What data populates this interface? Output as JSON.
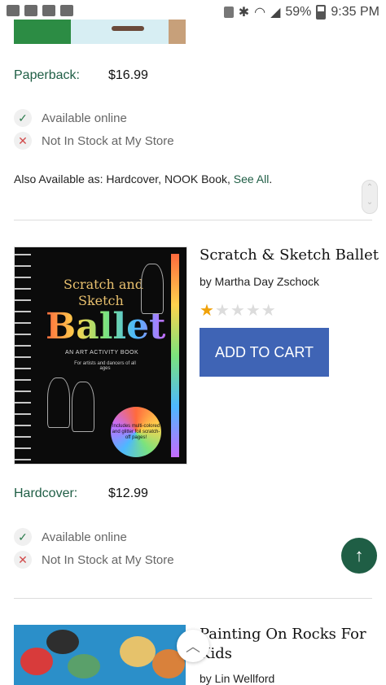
{
  "status_bar": {
    "battery": "59%",
    "time": "9:35 PM"
  },
  "top_item": {
    "format_label": "Paperback:",
    "price": "$16.99",
    "availability": [
      {
        "text": "Available online",
        "icon": "check-icon"
      },
      {
        "text": "Not In Stock at My Store",
        "icon": "x-icon"
      }
    ],
    "also_prefix": "Also Available as: ",
    "also_formats": "Hardcover, NOOK Book, ",
    "see_all": "See All",
    "also_suffix": "."
  },
  "product": {
    "title": "Scratch & Sketch Ballet",
    "author": "by Martha Day Zschock",
    "rating": 1,
    "rating_max": 5,
    "add_to_cart": "ADD TO CART",
    "cover_text": {
      "line1": "Scratch and",
      "line2": "Sketch",
      "line3": "Ballet",
      "subtitle": "AN ART ACTIVITY BOOK",
      "subtitle2": "For artists and dancers of all ages",
      "badge": "Includes multi-colored and glitter foil scratch-off pages!"
    },
    "format_label": "Hardcover:",
    "price": "$12.99",
    "availability": [
      {
        "text": "Available online",
        "icon": "check-icon"
      },
      {
        "text": "Not In Stock at My Store",
        "icon": "x-icon"
      }
    ]
  },
  "next_product": {
    "title": "Painting On Rocks For Kids",
    "author": "by Lin Wellford"
  },
  "colors": {
    "accent_green": "#1f5e45",
    "cart_blue": "#3f64b5",
    "star": "#f0a20a"
  }
}
